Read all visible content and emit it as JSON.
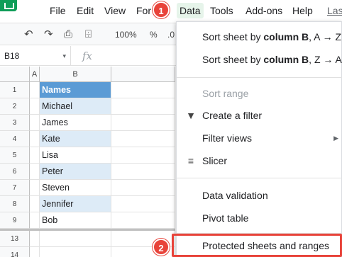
{
  "menu": {
    "items": [
      "File",
      "Edit",
      "View",
      "Format",
      "Data",
      "Tools",
      "Add-ons",
      "Help",
      "Last edit"
    ],
    "visible_labels": {
      "file": "File",
      "edit": "Edit",
      "view": "View",
      "format": "For",
      "data": "Data",
      "tools": "Tools",
      "addons": "Add-ons",
      "help": "Help",
      "last_edit": "Las"
    },
    "active": "Data"
  },
  "toolbar": {
    "undo_icon": "undo-icon",
    "redo_icon": "redo-icon",
    "print_icon": "print-icon",
    "paint_format_icon": "paint-format-icon",
    "zoom": "100%",
    "percent": "%",
    "decimal": ".0"
  },
  "formula_bar": {
    "cell_ref": "B18",
    "fx_label": "fx",
    "value": ""
  },
  "sheet": {
    "columns": [
      "A",
      "B"
    ],
    "rows": [
      {
        "num": "1",
        "value": "Names",
        "style": "header"
      },
      {
        "num": "2",
        "value": "Michael",
        "style": "band"
      },
      {
        "num": "3",
        "value": "James",
        "style": "plain"
      },
      {
        "num": "4",
        "value": "Kate",
        "style": "band"
      },
      {
        "num": "5",
        "value": "Lisa",
        "style": "plain"
      },
      {
        "num": "6",
        "value": "Peter",
        "style": "band"
      },
      {
        "num": "7",
        "value": "Steven",
        "style": "plain"
      },
      {
        "num": "8",
        "value": "Jennifer",
        "style": "band"
      },
      {
        "num": "9",
        "value": "Bob",
        "style": "plain"
      },
      {
        "num": "13",
        "value": "",
        "style": "plain"
      },
      {
        "num": "14",
        "value": "",
        "style": "plain"
      }
    ]
  },
  "data_menu": {
    "sort_az_prefix": "Sort sheet by ",
    "sort_az_bold": "column B",
    "sort_az_suffix": ", A → Z",
    "sort_za_prefix": "Sort sheet by ",
    "sort_za_bold": "column B",
    "sort_za_suffix": ", Z → A",
    "sort_range": "Sort range",
    "create_filter": "Create a filter",
    "filter_views": "Filter views",
    "slicer": "Slicer",
    "data_validation": "Data validation",
    "pivot_table": "Pivot table",
    "protected": "Protected sheets and ranges"
  },
  "callouts": {
    "step1": "1",
    "step2": "2"
  },
  "colors": {
    "header_fill": "#5b9bd5",
    "band_fill": "#ddebf7",
    "callout": "#e8433a",
    "active_menu": "#e6f4ea"
  }
}
